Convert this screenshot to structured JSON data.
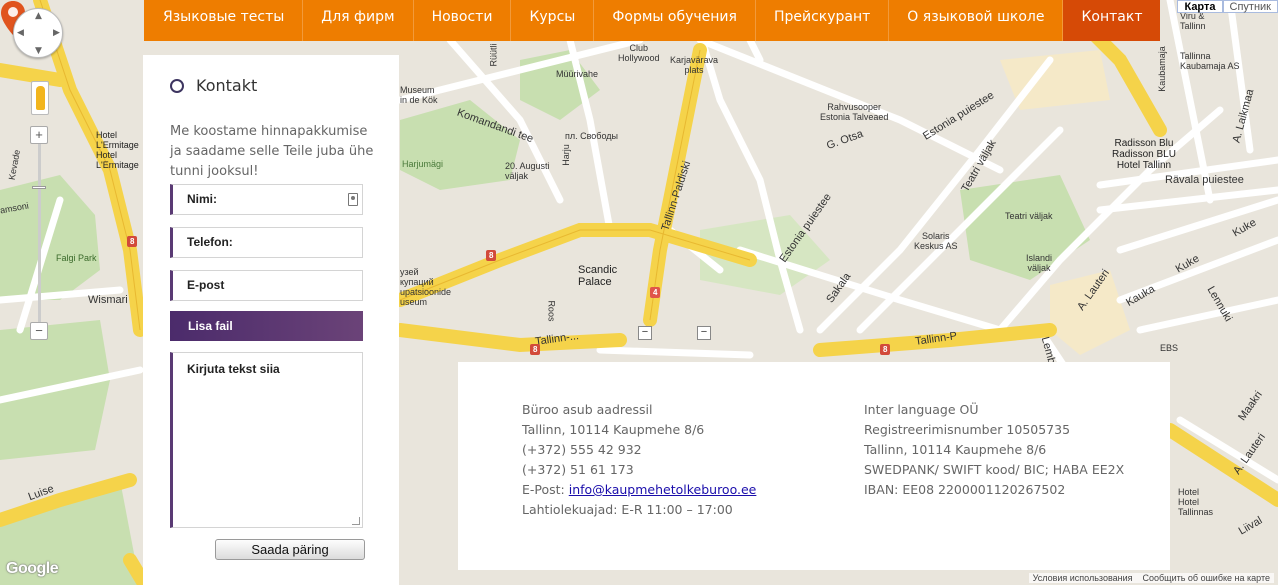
{
  "nav": {
    "items": [
      {
        "label": "Языковые тесты",
        "active": false
      },
      {
        "label": "Для фирм",
        "active": false
      },
      {
        "label": "Новости",
        "active": false
      },
      {
        "label": "Курсы",
        "active": false
      },
      {
        "label": "Формы обучения",
        "active": false
      },
      {
        "label": "Прейскурант",
        "active": false
      },
      {
        "label": "О языковой школе",
        "active": false
      },
      {
        "label": "Контакт",
        "active": true
      }
    ],
    "bg_color": "#ee7d00",
    "active_color": "#d64a06"
  },
  "map": {
    "type_options": {
      "map": "Карта",
      "satellite": "Спутник"
    },
    "zoom": {
      "plus": "+",
      "minus": "−"
    },
    "google_logo": "Google",
    "attribution": {
      "terms": "Условия использования",
      "report": "Сообщить об ошибке на карте"
    },
    "labels": {
      "ruutli": "Rüütli",
      "club_hollywood": "Club\nHollywood",
      "karjavarava": "Karjavärava\nplats",
      "muurivahe": "Müürivahe",
      "museum_kiek": "Museum\nin de Kök",
      "komandandi": "Komandandi tee",
      "svobody": "пл. Свободы",
      "harju": "Harju",
      "harjumagi": "Harjumägi",
      "augusti": "20. Augusti\nväljak",
      "tallinn_paldiski": "Tallinn-Paldiski",
      "scandic": "Scandic\nPalace",
      "roos": "Roos",
      "tallinn_road": "Tallinn-...",
      "tallinn_p": "Tallinn-P",
      "hotel_ermitage": "Hotel\nL'Ermitage\nHotel\nL'Ermitage",
      "kevade": "Kevade",
      "samsoni": "amsoni",
      "falgi_park": "Falgi Park",
      "wismari": "Wismari",
      "luise": "Luise",
      "museum_cyr": "узей\nкупаций\nupatsioonide\nuseum",
      "estonia_puiestee_top": "Estonia puiestee",
      "estonia_puiestee_mid": "Estonia puiestee",
      "rahvusooper": "Rahvusooper\nEstonia Talveaed",
      "g_otsa": "G. Otsa",
      "teatri_valjak": "Teatri väljak",
      "teatri_valjak2": "Teatri väljak",
      "sakala": "Sakala",
      "solaris": "Solaris\nKeskus AS",
      "islandi": "Islandi\nväljak",
      "a_lauteri": "A. Lauteri",
      "kauka": "Kauka",
      "kuke": "Kuke",
      "kuke2": "Kuke",
      "lennuki": "Lennuki",
      "ravala": "Rävala puiestee",
      "radisson": "Radisson Blu\nRadisson BLU\nHotel Tallinn",
      "kaubamaja": "Kaubamaja",
      "tallinna_kaubamaja": "Tallinna\nKaubamaja AS",
      "a_laikmaa": "A. Laikmaa",
      "ebs": "EBS",
      "maakri": "Maakri",
      "a_lauteri2": "A. Lauteri",
      "lembitu": "Lembitu",
      "liivalaia": "Liival",
      "hotel_bottom": "Hotel\nHotel\nTallinnas",
      "tallinn_viru": "Viru &\nTallinn"
    },
    "route_badges": [
      "8",
      "8",
      "4",
      "8",
      "8",
      "8"
    ]
  },
  "form": {
    "heading": "Kontakt",
    "intro": "Me koostame hinnapakkumise ja saadame selle Teile juba ühe tunni jooksul!",
    "name_label": "Nimi:",
    "phone_label": "Telefon:",
    "email_label": "E-post",
    "file_label": "Lisa fail",
    "message_label": "Kirjuta tekst siia",
    "submit_label": "Saada päring"
  },
  "info": {
    "left": {
      "line1": "Büroo asub aadressil",
      "line2": "Tallinn, 10114 Kaupmehe 8/6",
      "line3": "(+372) 555 42 932",
      "line4": "(+372) 51 61 173",
      "email_prefix": "E-Post: ",
      "email": "info@kaupmehetolkeburoo.ee",
      "hours": "Lahtiolekuajad: E-R 11:00 – 17:00"
    },
    "right": {
      "line1": "Inter language OÜ",
      "line2": "Registreerimisnumber  10505735",
      "line3": "Tallinn, 10114 Kaupmehe 8/6",
      "line4": "SWEDPANK/ SWIFT kood/ BIC; HABA EE2X",
      "line5": "IBAN: EE08 2200001120267502"
    }
  },
  "colors": {
    "form_accent": "#5a3a74",
    "pin": "#e0541e"
  }
}
